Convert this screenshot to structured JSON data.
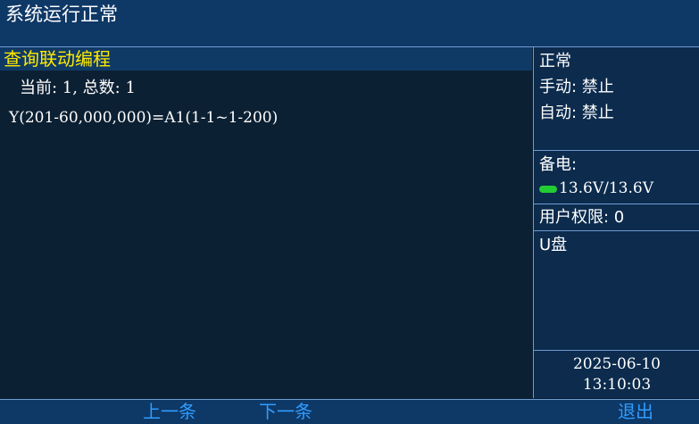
{
  "title": "系统运行正常",
  "main": {
    "section_title": "查询联动编程",
    "summary": "当前: 1, 总数: 1",
    "program_line": "Y(201-60,000,000)=A1(1-1~1-200)"
  },
  "sidebar": {
    "status": "正常",
    "manual": "手动: 禁止",
    "auto": "自动: 禁止",
    "backup_label": "备电:",
    "backup_voltage": "13.6V/13.6V",
    "user_permission": "用户权限: 0",
    "usb_label": "U盘",
    "date": "2025-06-10",
    "time": "13:10:03"
  },
  "footer": {
    "prev": "上一条",
    "next": "下一条",
    "exit": "退出"
  },
  "colors": {
    "background": "#0c2033",
    "bar": "#0e3866",
    "section_title": "#ffea00",
    "footer_button": "#2f9cff",
    "battery": "#22cc33"
  },
  "icons": {
    "battery": "battery-icon"
  }
}
